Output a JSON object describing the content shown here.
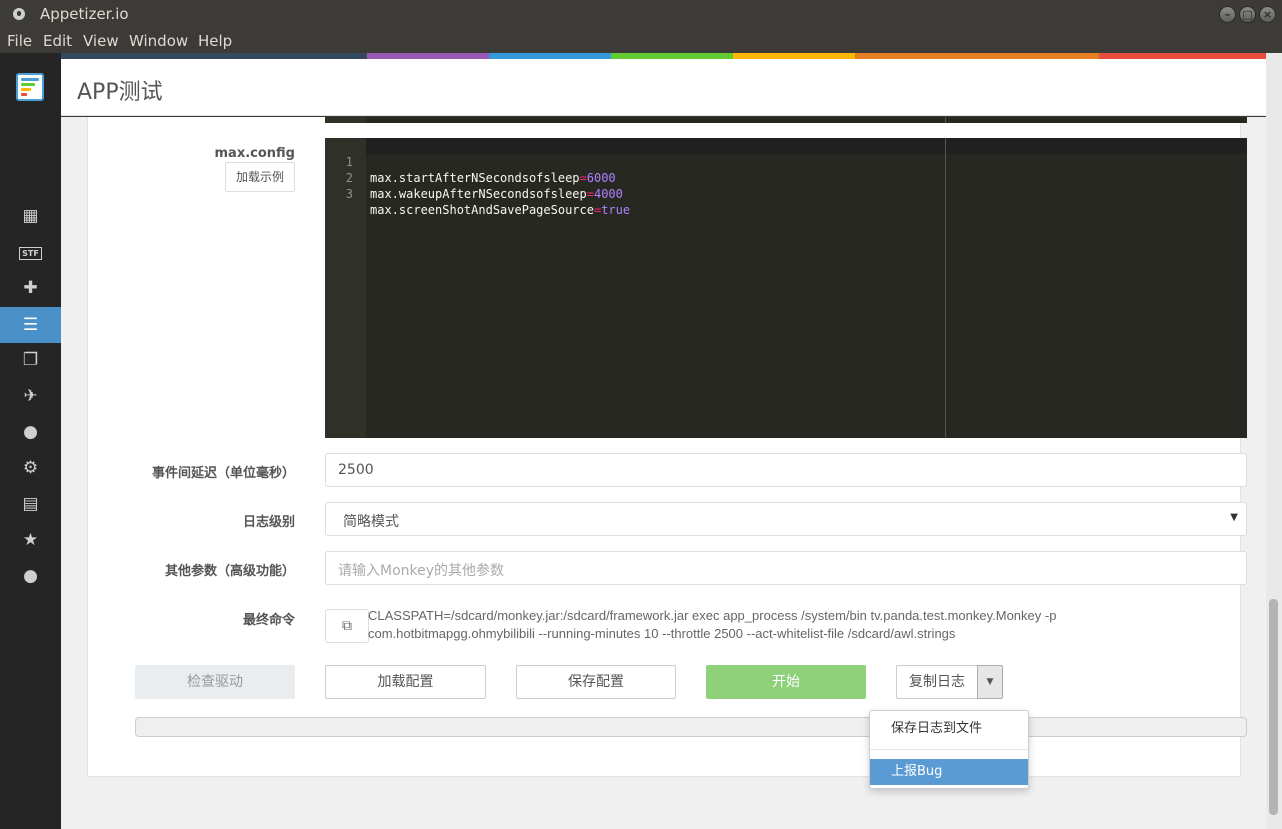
{
  "window": {
    "title": "Appetizer.io",
    "buttons": [
      "–",
      "□",
      "×"
    ]
  },
  "menubar": [
    "File",
    "Edit",
    "View",
    "Window",
    "Help"
  ],
  "sidebar": {
    "items": [
      {
        "icon": "grid-icon",
        "glyph": "▦"
      },
      {
        "icon": "stf-icon",
        "glyph": "STF"
      },
      {
        "icon": "puzzle-icon",
        "glyph": "✚"
      },
      {
        "icon": "server-list-icon",
        "glyph": "☰",
        "active": true
      },
      {
        "icon": "files-icon",
        "glyph": "❐"
      },
      {
        "icon": "rocket-icon",
        "glyph": "✈"
      },
      {
        "icon": "user-icon",
        "glyph": "●"
      },
      {
        "icon": "gear-icon",
        "glyph": "⚙"
      },
      {
        "icon": "book-icon",
        "glyph": "▤"
      },
      {
        "icon": "star-icon",
        "glyph": "★"
      },
      {
        "icon": "chat-icon",
        "glyph": "●"
      }
    ]
  },
  "colorbar": [
    "#34495e",
    "#9b59b6",
    "#3498db",
    "#62cb31",
    "#ffb606",
    "#e67e22",
    "#e74c3c"
  ],
  "header": {
    "title": "APP测试"
  },
  "maxconfig": {
    "label": "max.config",
    "example_button": "加载示例",
    "lines": [
      {
        "n": "1",
        "key": "max.startAfterNSecondsofsleep",
        "value": "6000"
      },
      {
        "n": "2",
        "key": "max.wakeupAfterNSecondsofsleep",
        "value": "4000"
      },
      {
        "n": "3",
        "key": "max.screenShotAndSavePageSource",
        "value": "true"
      }
    ]
  },
  "form": {
    "delay_label": "事件间延迟（单位毫秒）",
    "delay_value": "2500",
    "log_label": "日志级别",
    "log_value": "简略模式",
    "extra_label": "其他参数（高级功能）",
    "extra_placeholder": "请输入Monkey的其他参数",
    "cmd_label": "最终命令",
    "cmd_line1": "CLASSPATH=/sdcard/monkey.jar:/sdcard/framework.jar exec app_process /system/bin tv.panda.test.monkey.Monkey -p",
    "cmd_line2": "com.hotbitmapgg.ohmybilibili --running-minutes 10 --throttle 2500 --act-whitelist-file /sdcard/awl.strings"
  },
  "buttons": {
    "check_driver": "检查驱动",
    "load_config": "加载配置",
    "save_config": "保存配置",
    "start": "开始",
    "copy_log": "复制日志"
  },
  "dropdown": {
    "items": [
      "保存日志到文件",
      "上报Bug"
    ]
  }
}
